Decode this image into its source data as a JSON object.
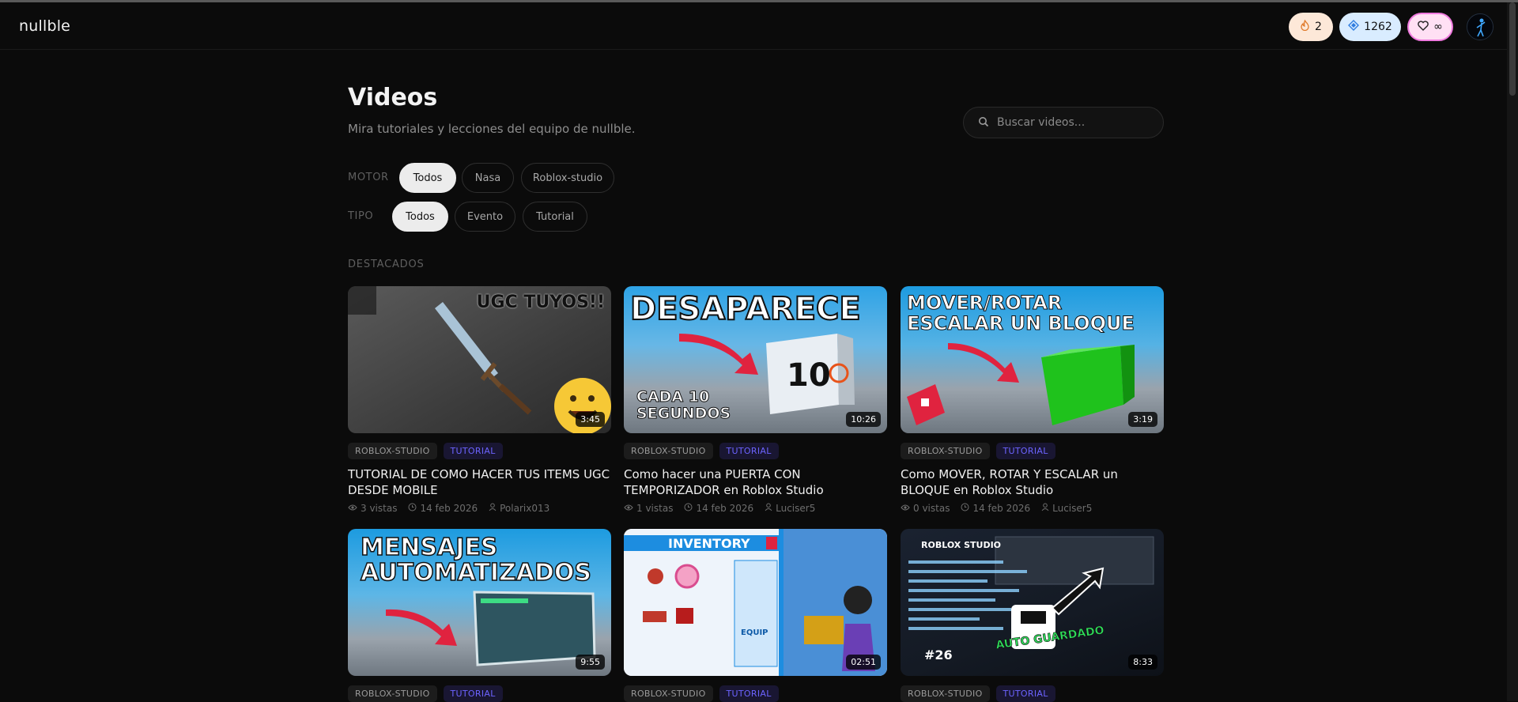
{
  "app": {
    "logo": "nullble"
  },
  "header": {
    "streak": "2",
    "gems": "1262",
    "lives": "∞"
  },
  "page": {
    "title": "Videos",
    "subtitle": "Mira tutoriales y lecciones del equipo de nullble.",
    "search_placeholder": "Buscar videos..."
  },
  "filters": {
    "motor": {
      "label": "MOTOR",
      "options": [
        "Todos",
        "Nasa",
        "Roblox-studio"
      ],
      "selected": "Todos"
    },
    "tipo": {
      "label": "TIPO",
      "options": [
        "Todos",
        "Evento",
        "Tutorial"
      ],
      "selected": "Todos"
    }
  },
  "section": {
    "label": "DESTACADOS"
  },
  "videos": [
    {
      "engine": "ROBLOX-STUDIO",
      "type": "TUTORIAL",
      "title": "TUTORIAL DE COMO HACER TUS ITEMS UGC DESDE MOBILE",
      "views": "3 vistas",
      "date": "14 feb 2026",
      "author": "Polarix013",
      "duration": "3:45",
      "thumb_text": "UGC TUYOS!!"
    },
    {
      "engine": "ROBLOX-STUDIO",
      "type": "TUTORIAL",
      "title": "Como hacer una PUERTA CON TEMPORIZADOR en Roblox Studio",
      "views": "1 vistas",
      "date": "14 feb 2026",
      "author": "Luciser5",
      "duration": "10:26",
      "thumb_text": "DESAPARECE",
      "thumb_sub": "CADA 10 SEGUNDOS",
      "thumb_num": "10"
    },
    {
      "engine": "ROBLOX-STUDIO",
      "type": "TUTORIAL",
      "title": "Como MOVER, ROTAR Y ESCALAR un BLOQUE en Roblox Studio",
      "views": "0 vistas",
      "date": "14 feb 2026",
      "author": "Luciser5",
      "duration": "3:19",
      "thumb_text": "MOVER/ROTAR ESCALAR UN BLOQUE"
    },
    {
      "engine": "ROBLOX-STUDIO",
      "type": "TUTORIAL",
      "duration": "9:55",
      "thumb_text": "MENSAJES AUTOMATIZADOS"
    },
    {
      "engine": "ROBLOX-STUDIO",
      "type": "TUTORIAL",
      "duration": "02:51",
      "thumb_text": "INVENTORY",
      "thumb_sub": "EQUIP"
    },
    {
      "engine": "ROBLOX-STUDIO",
      "type": "TUTORIAL",
      "duration": "8:33",
      "thumb_text": "ROBLOX STUDIO",
      "thumb_sub": "AUTO GUARDADO",
      "thumb_num": "#26"
    }
  ],
  "colors": {
    "background": "#0b0b0b",
    "tutorial_tag": "#6c63ff",
    "streak_pill": "#fde8d8",
    "gems_pill": "#d9ecff",
    "lives_pill": "#ffe0f4"
  }
}
